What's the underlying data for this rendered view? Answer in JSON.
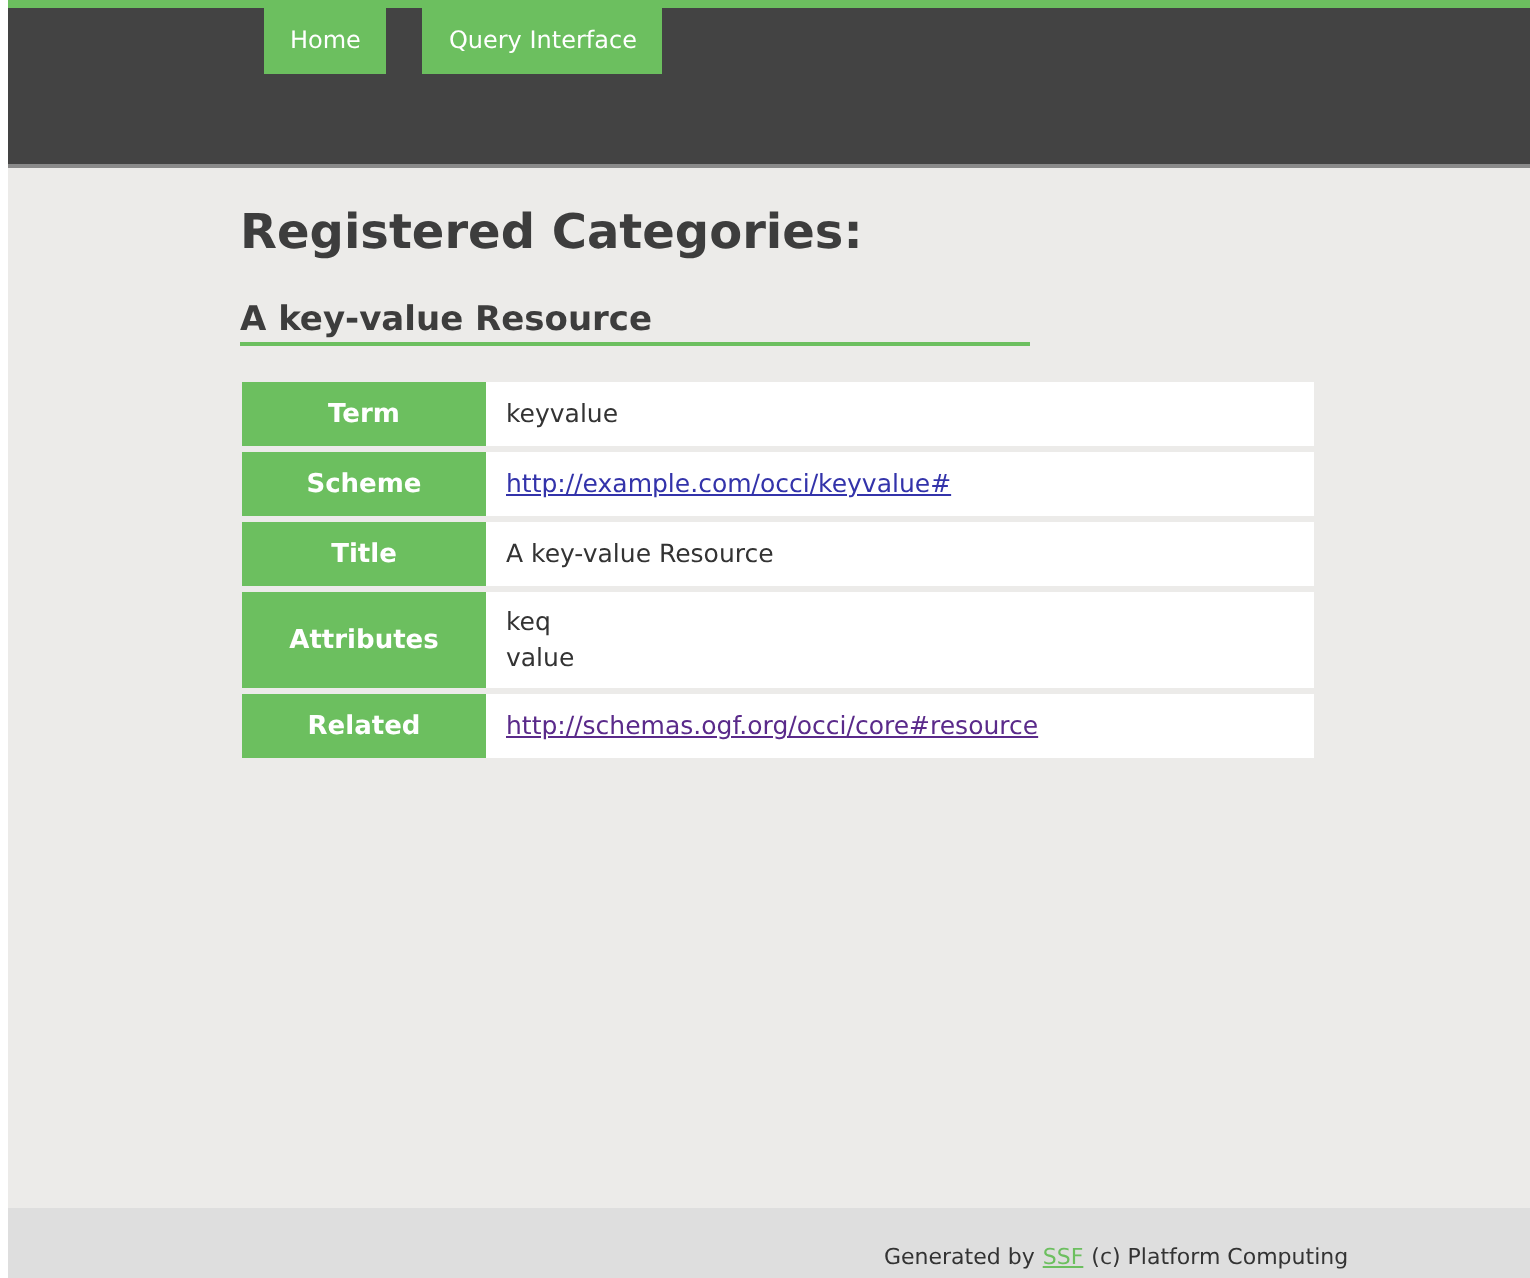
{
  "nav": [
    {
      "label": "Home"
    },
    {
      "label": "Query Interface"
    }
  ],
  "heading": "Registered Categories:",
  "category": {
    "title": "A key-value Resource",
    "rows": [
      {
        "label": "Term",
        "kind": "text",
        "lines": [
          "keyvalue"
        ]
      },
      {
        "label": "Scheme",
        "kind": "link",
        "visited": false,
        "lines": [
          "http://example.com/occi/keyvalue#"
        ]
      },
      {
        "label": "Title",
        "kind": "text",
        "lines": [
          "A key-value Resource"
        ]
      },
      {
        "label": "Attributes",
        "kind": "text",
        "lines": [
          "keq",
          "value"
        ]
      },
      {
        "label": "Related",
        "kind": "link",
        "visited": true,
        "lines": [
          "http://schemas.ogf.org/occi/core#resource"
        ]
      }
    ]
  },
  "footer": {
    "before": "Generated by",
    "link": "SSF",
    "after": "(c) Platform Computing"
  }
}
